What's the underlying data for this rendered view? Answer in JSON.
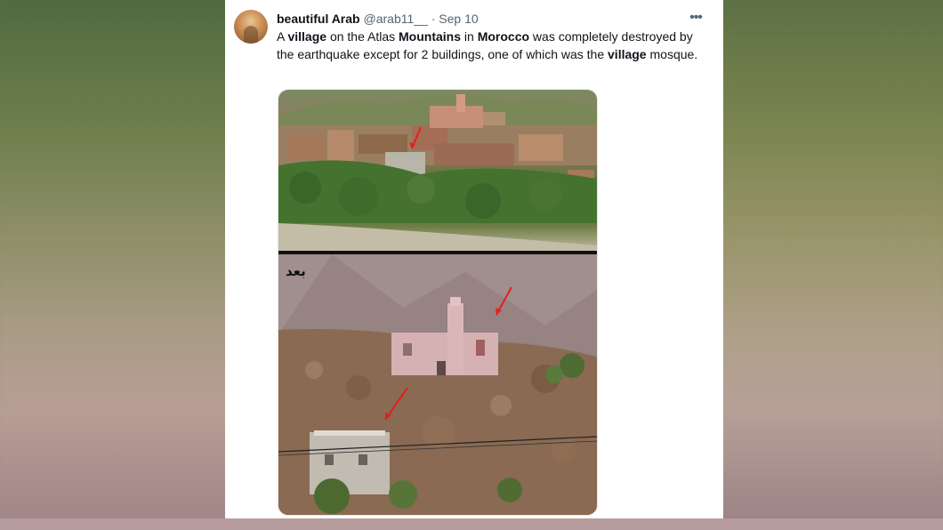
{
  "tweet": {
    "author_name": "beautiful Arab",
    "handle": "@arab11__",
    "separator": "·",
    "date": "Sep 10",
    "more_label": "•••",
    "text_parts": [
      {
        "t": "A ",
        "b": false
      },
      {
        "t": "village",
        "b": true
      },
      {
        "t": " on the Atlas ",
        "b": false
      },
      {
        "t": "Mountains",
        "b": true
      },
      {
        "t": " in ",
        "b": false
      },
      {
        "t": "Morocco",
        "b": true
      },
      {
        "t": " was completely destroyed by the earthquake except for 2 buildings, one of which was the ",
        "b": false
      },
      {
        "t": "village",
        "b": true
      },
      {
        "t": " mosque.",
        "b": false
      }
    ],
    "media": {
      "bottom_caption": "بعد"
    }
  },
  "colors": {
    "card_bg": "#ffffff",
    "arrow_red": "#e0201c",
    "secondary_text": "#536471"
  }
}
